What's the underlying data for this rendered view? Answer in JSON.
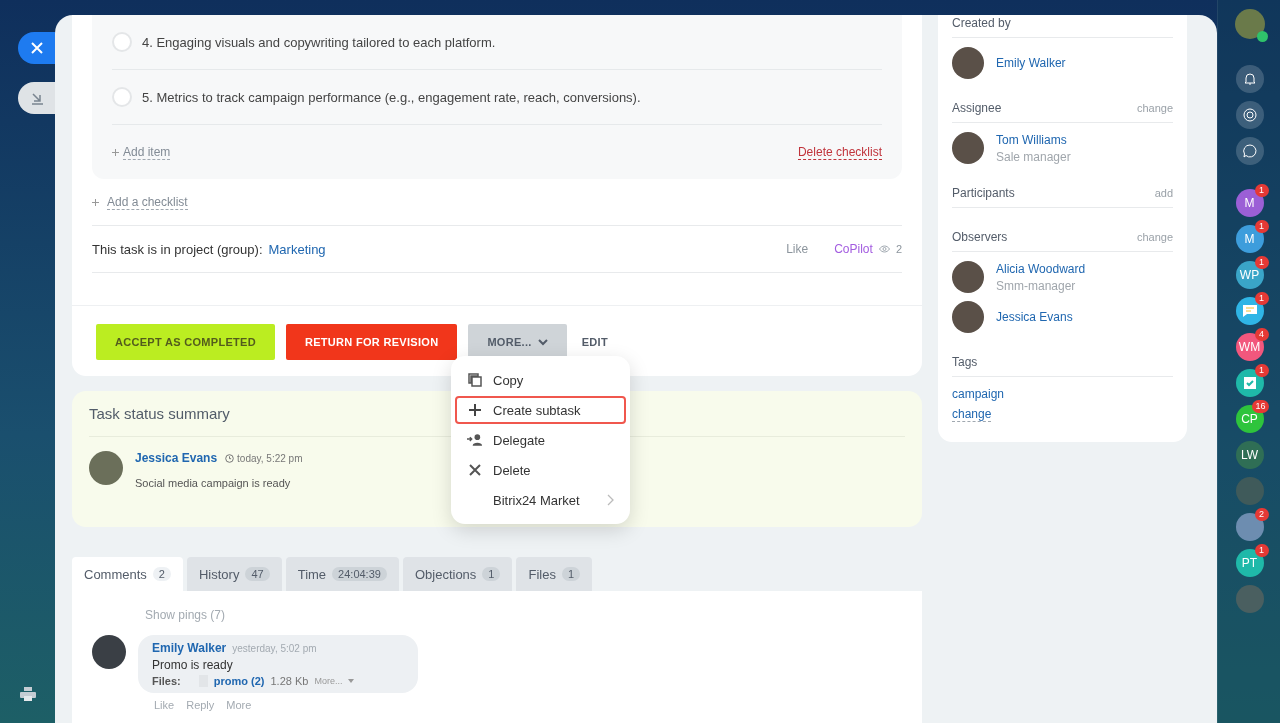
{
  "checklist": {
    "items": [
      {
        "text": "4. Engaging visuals and copywriting tailored to each platform.",
        "checked": false
      },
      {
        "text": "5. Metrics to track campaign performance (e.g., engagement rate, reach, conversions).",
        "checked": false
      }
    ],
    "add_item": "Add item",
    "delete": "Delete checklist"
  },
  "add_checklist": "Add a checklist",
  "project": {
    "label": "This task is in project (group):",
    "link": "Marketing",
    "like": "Like",
    "copilot": "CoPilot",
    "views": "2"
  },
  "actions": [
    {
      "label": "ACCEPT AS COMPLETED",
      "kind": "accept"
    },
    {
      "label": "RETURN FOR REVISION",
      "kind": "return"
    },
    {
      "label": "MORE...",
      "kind": "more"
    },
    {
      "label": "EDIT",
      "kind": "edit"
    }
  ],
  "menu": [
    {
      "label": "Copy",
      "kind": "copy",
      "highlighted": false
    },
    {
      "label": "Create subtask",
      "kind": "create",
      "highlighted": true
    },
    {
      "label": "Delegate",
      "kind": "delegate",
      "highlighted": false
    },
    {
      "label": "Delete",
      "kind": "delete",
      "highlighted": false
    },
    {
      "label": "Bitrix24 Market",
      "kind": "submenu",
      "highlighted": false
    }
  ],
  "summary": {
    "title": "Task status summary",
    "author": "Jessica Evans",
    "time": "today, 5:22 pm",
    "text": "Social media campaign is ready"
  },
  "tabs": [
    {
      "label": "Comments",
      "count": "2",
      "selected": true
    },
    {
      "label": "History",
      "count": "47",
      "selected": false
    },
    {
      "label": "Time",
      "count": "24:04:39",
      "selected": false
    },
    {
      "label": "Objections",
      "count": "1",
      "selected": false
    },
    {
      "label": "Files",
      "count": "1",
      "selected": false
    }
  ],
  "comments": {
    "show_pings": "Show pings (7)",
    "author": "Emily Walker",
    "time": "yesterday, 5:02 pm",
    "text": "Promo is ready",
    "files_label": "Files:",
    "file_name": "promo (2)",
    "file_size": "1.28 Kb",
    "more": "More...",
    "actions": [
      "Like",
      "Reply",
      "More"
    ]
  },
  "sidebar": [
    {
      "title": "Created by",
      "people": [
        {
          "name": "Emily Walker"
        }
      ]
    },
    {
      "title": "Assignee",
      "action": "change",
      "people": [
        {
          "name": "Tom Williams",
          "role": "Sale manager"
        }
      ]
    },
    {
      "title": "Participants",
      "action": "add"
    },
    {
      "title": "Observers",
      "action": "change",
      "people": [
        {
          "name": "Alicia Woodward",
          "role": "Smm-manager"
        },
        {
          "name": "Jessica Evans"
        }
      ]
    }
  ],
  "tags": {
    "title": "Tags",
    "items": [
      "campaign"
    ],
    "change": "change"
  },
  "right_bar": [
    {
      "kind": "initials",
      "initials": "M",
      "color": "#9b5fd6",
      "badge": "1"
    },
    {
      "kind": "initials",
      "initials": "M",
      "color": "#3d9ddc",
      "badge": "1"
    },
    {
      "kind": "initials",
      "initials": "WP",
      "color": "#3aa5c8",
      "badge": "1"
    },
    {
      "kind": "chat",
      "color": "#2fb5e6",
      "badge": "1"
    },
    {
      "kind": "initials",
      "initials": "WM",
      "color": "#f2577d",
      "badge": "4"
    },
    {
      "kind": "task",
      "color": "#1fb9a9",
      "badge": "1"
    },
    {
      "kind": "initials",
      "initials": "CP",
      "color": "#2ec43c",
      "badge": "16"
    },
    {
      "kind": "initials",
      "initials": "LW",
      "color": "#2f6e55"
    },
    {
      "kind": "photo",
      "color": "#3f5a5a"
    },
    {
      "kind": "photo",
      "color": "#6d8db0",
      "badge": "2"
    },
    {
      "kind": "initials",
      "initials": "PT",
      "color": "#1fb9a9",
      "badge": "1"
    },
    {
      "kind": "photo",
      "color": "#4a5f60"
    }
  ]
}
